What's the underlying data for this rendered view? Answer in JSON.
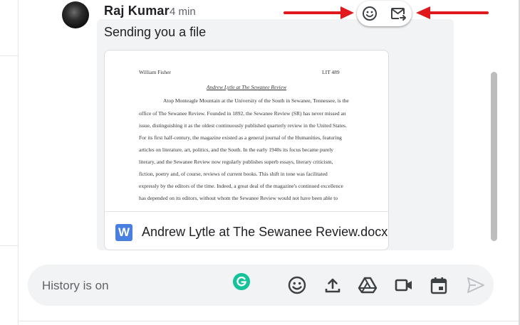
{
  "message": {
    "sender": "Raj Kumar",
    "timestamp": "4 min",
    "text": "Sending you a file"
  },
  "attachment": {
    "file_name": "Andrew Lytle at The Sewanee Review.docx",
    "file_type_letter": "W",
    "preview": {
      "author": "William Fisher",
      "course": "LIT 489",
      "title": "Andrew Lytle at The Sewanee Review",
      "lines": [
        "Atop Monteagle Mountain at the University of the South in Sewanee, Tennessee, is the",
        "office of The Sewanee Review. Founded in 1892, the Sewanee Review (SR) has never missed an",
        "issue, distinguishing it as the oldest continuously published quarterly review in the United States.",
        "For its first half-century, the magazine existed as a general journal of the Humanities, featuring",
        "articles on literature, art, politics, and the South. In the early 1940s its focus became purely",
        "literary, and the Sewanee Review now regularly publishes superb essays, literary criticism,",
        "fiction, poetry and, of course, reviews of current books. This shift in tone was facilitated",
        "expressly by the editors of the time. Indeed, a great deal of the magazine's continued excellence",
        "has depended on its editors, without whom the Sewanee Review would not have been able to"
      ]
    }
  },
  "hover_actions": {
    "emoji_icon": "smiley-face",
    "forward_icon": "forward-to-inbox"
  },
  "composer": {
    "placeholder": "History is on",
    "tools": [
      "emoji-icon",
      "upload-icon",
      "google-drive-icon",
      "video-meet-icon",
      "calendar-icon",
      "send-icon"
    ]
  },
  "colors": {
    "annotation_arrow": "#e0191f",
    "grammarly": "#15c39a",
    "word_blue": "#4a7fe2",
    "bubble_bg": "#f1f3f4"
  }
}
